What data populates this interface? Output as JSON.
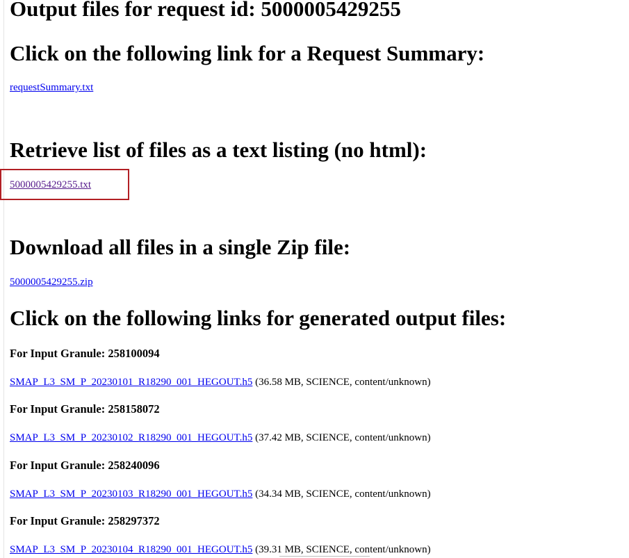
{
  "request": {
    "title": "Output files for request id: 5000005429255"
  },
  "summary": {
    "heading": "Click on the following link for a Request Summary:",
    "link_label": "requestSummary.txt"
  },
  "listing": {
    "heading": "Retrieve list of files as a text listing (no html):",
    "link_label": "5000005429255.txt"
  },
  "zip": {
    "heading": "Download all files in a single Zip file:",
    "link_label": "5000005429255.zip"
  },
  "outputs": {
    "heading": "Click on the following links for generated output files:",
    "granules": [
      {
        "label": "For Input Granule: 258100094",
        "file_label": "SMAP_L3_SM_P_20230101_R18290_001_HEGOUT.h5",
        "meta": "(36.58 MB, SCIENCE, content/unknown)"
      },
      {
        "label": "For Input Granule: 258158072",
        "file_label": "SMAP_L3_SM_P_20230102_R18290_001_HEGOUT.h5",
        "meta": "(37.42 MB, SCIENCE, content/unknown)"
      },
      {
        "label": "For Input Granule: 258240096",
        "file_label": "SMAP_L3_SM_P_20230103_R18290_001_HEGOUT.h5",
        "meta": "(34.34 MB, SCIENCE, content/unknown)"
      },
      {
        "label": "For Input Granule: 258297372",
        "file_label": "SMAP_L3_SM_P_20230104_R18290_001_HEGOUT.h5",
        "meta": "(39.31 MB, SCIENCE, content/unknown)"
      }
    ]
  },
  "colors": {
    "link": "#0000ee",
    "visited_link": "#551a8b",
    "highlight_border": "#b21f24"
  }
}
